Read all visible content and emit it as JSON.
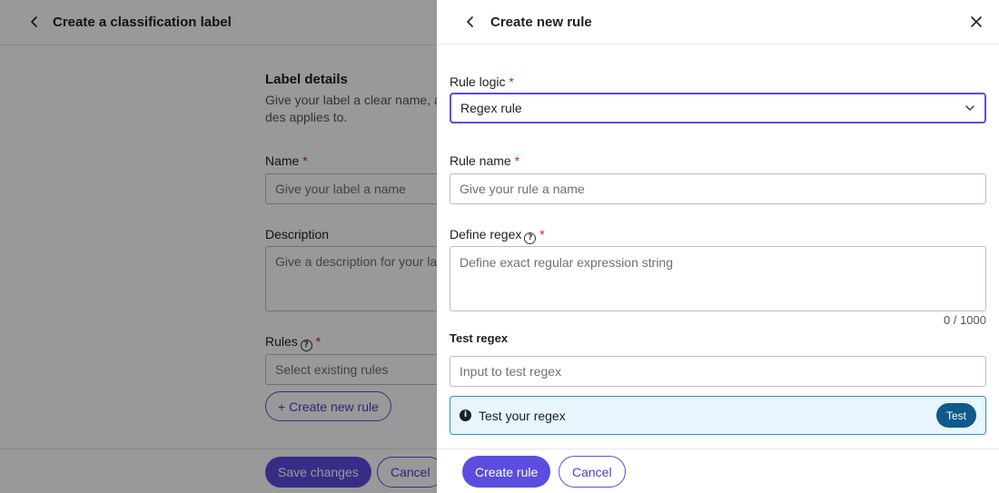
{
  "background_page": {
    "title": "Create a classification label",
    "section_title": "Label details",
    "section_description": "Give your label a clear name, a des applies to.",
    "name_label": "Name",
    "name_placeholder": "Give your label a name",
    "description_label": "Description",
    "description_placeholder": "Give a description for your label",
    "rules_label": "Rules",
    "rules_placeholder": "Select existing rules",
    "create_rule_button": "+ Create new rule",
    "save_button": "Save changes",
    "cancel_button": "Cancel"
  },
  "panel": {
    "title": "Create new rule",
    "rule_logic_label": "Rule logic",
    "rule_logic_value": "Regex rule",
    "rule_name_label": "Rule name",
    "rule_name_placeholder": "Give your rule a name",
    "define_regex_label": "Define regex",
    "define_regex_placeholder": "Define exact regular expression string",
    "char_counter": "0 / 1000",
    "test_regex_label": "Test regex",
    "test_input_placeholder": "Input to test regex",
    "test_message": "Test your regex",
    "test_button": "Test",
    "create_button": "Create rule",
    "cancel_button": "Cancel"
  },
  "required_marker": "*",
  "colors": {
    "accent": "#5b4de0",
    "info_border": "#2f8fd8",
    "info_bg": "#e9f5fd",
    "test_button": "#0e5a8a",
    "required": "#c5221f"
  }
}
